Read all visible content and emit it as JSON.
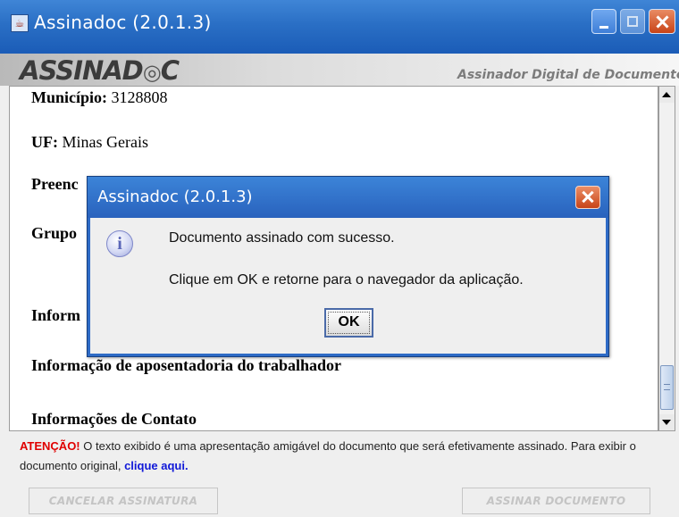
{
  "window": {
    "title": "Assinadoc (2.0.1.3)",
    "app_icon": "java-cup-icon"
  },
  "banner": {
    "logo": "ASSINAD",
    "logo_suffix": "C",
    "tagline": "Assinador Digital de Documentos"
  },
  "document": {
    "municipio_label": "Município:",
    "municipio_value": "3128808",
    "uf_label": "UF:",
    "uf_value": "Minas Gerais",
    "partial_preenc": "Preenc",
    "partial_grupo": "Grupo",
    "partial_inform": "Inform",
    "heading_aposentadoria": "Informação de aposentadoria do trabalhador",
    "heading_contato": "Informações de Contato"
  },
  "notice": {
    "warning": "ATENÇÃO!",
    "text_before_link": " O texto exibido é uma apresentação amigável do documento que será efetivamente assinado. Para exibir o documento original, ",
    "link": "clique aqui."
  },
  "buttons": {
    "cancel": "CANCELAR ASSINATURA",
    "sign": "ASSINAR DOCUMENTO"
  },
  "dialog": {
    "title": "Assinadoc (2.0.1.3)",
    "message_line1": "Documento assinado com sucesso.",
    "message_line2": "Clique em OK e retorne para o navegador da aplicação.",
    "ok_label": "OK",
    "icon": "info-icon"
  },
  "colors": {
    "titlebar": "#2a6fc5",
    "warning": "#e00000",
    "link": "#1018d8"
  }
}
